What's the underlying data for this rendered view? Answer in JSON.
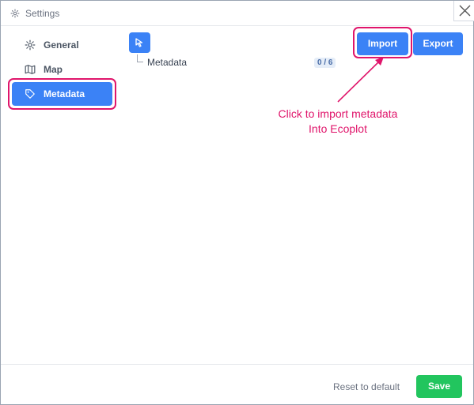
{
  "window": {
    "title": "Settings"
  },
  "sidebar": {
    "items": [
      {
        "label": "General",
        "icon": "gear-icon"
      },
      {
        "label": "Map",
        "icon": "map-icon"
      },
      {
        "label": "Metadata",
        "icon": "tag-icon",
        "active": true
      }
    ]
  },
  "metadata_panel": {
    "tree_item": "Metadata",
    "count": "0 / 6"
  },
  "toolbar": {
    "import_label": "Import",
    "export_label": "Export"
  },
  "annotation": {
    "line1": "Click to import metadata",
    "line2": "Into Ecoplot"
  },
  "footer": {
    "reset_label": "Reset to default",
    "save_label": "Save"
  },
  "colors": {
    "primary": "#3b82f6",
    "success": "#22c55e",
    "annotation": "#e0156b"
  }
}
